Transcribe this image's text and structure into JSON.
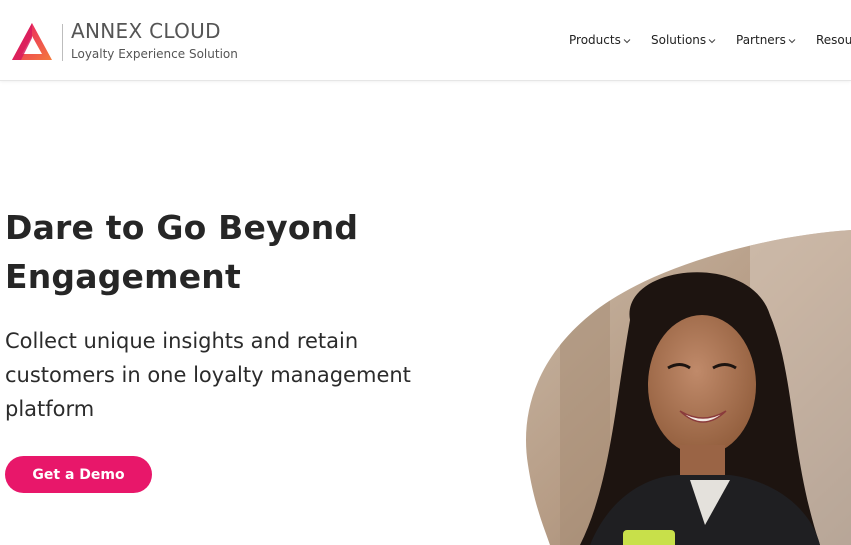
{
  "header": {
    "brand": "ANNEX CLOUD",
    "tagline": "Loyalty Experience Solution",
    "logo_colors": [
      "#e8176a",
      "#f47a3c"
    ],
    "nav": [
      {
        "label": "Products",
        "icon": "chevron-down-icon"
      },
      {
        "label": "Solutions",
        "icon": "chevron-down-icon"
      },
      {
        "label": "Partners",
        "icon": "chevron-down-icon"
      },
      {
        "label": "Resou",
        "icon": "chevron-down-icon"
      }
    ]
  },
  "hero": {
    "title_line1": "Dare to Go Beyond",
    "title_line2": "Engagement",
    "subtitle": "Collect unique insights and retain customers in one loyalty management platform",
    "cta_label": "Get a Demo",
    "accent_color": "#e8176a",
    "image": "woman-smiling-at-phone-photo"
  }
}
